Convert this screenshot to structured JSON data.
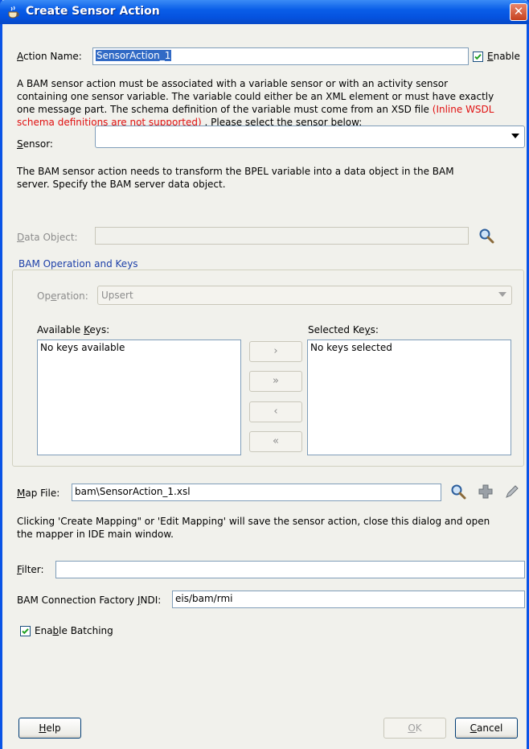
{
  "window": {
    "title": "Create Sensor Action",
    "close_glyph": "✕"
  },
  "action_name": {
    "label": "Action Name:",
    "mnemonic": "A",
    "rest": "ction Name:",
    "value": "SensorAction_1"
  },
  "enable": {
    "label_pre": "",
    "mnemonic": "E",
    "label_rest": "nable",
    "checked": true
  },
  "intro": {
    "line1": "A BAM sensor action must be associated with a variable sensor or with an activity sensor",
    "line2": "containing one sensor variable. The variable could either be an XML element or must have exactly",
    "line3_black": "one message part. The schema definition of the variable must come from an XSD file ",
    "line3_red": "(Inline WSDL",
    "line4_red": "schema definitions are not supported)",
    "line4_black": " . Please select the sensor below:"
  },
  "sensor": {
    "mnemonic": "S",
    "rest": "ensor:",
    "value": ""
  },
  "transform_text": {
    "line1": "The BAM sensor action needs to transform the BPEL variable into a data object in the BAM",
    "line2": "server. Specify the BAM server data object."
  },
  "data_object": {
    "mnemonic": "D",
    "rest": "ata Object:",
    "value": ""
  },
  "bam_group": {
    "title": "BAM Operation and Keys",
    "operation_pre": "Op",
    "operation_mnemonic": "e",
    "operation_rest": "ration:",
    "operation_value": "Upsert",
    "available_pre": "Available ",
    "available_mnemonic": "K",
    "available_rest": "eys:",
    "available_empty": "No keys available",
    "selected_pre": "Selected Ke",
    "selected_mnemonic": "y",
    "selected_rest": "s:",
    "selected_empty": "No keys selected",
    "shuttle_add": "›",
    "shuttle_add_all": "»",
    "shuttle_remove": "‹",
    "shuttle_remove_all": "«"
  },
  "map_file": {
    "mnemonic": "M",
    "rest": "ap File:",
    "value": "bam\\SensorAction_1.xsl"
  },
  "mapping_note": {
    "line1": "Clicking 'Create Mapping\" or 'Edit Mapping' will save the sensor action, close this dialog and open",
    "line2": "the mapper in IDE main window."
  },
  "filter": {
    "mnemonic": "F",
    "rest": "ilter:",
    "value": ""
  },
  "jndi": {
    "pre": "BAM Connection Factory ",
    "mnemonic": "J",
    "rest": "NDI:",
    "value": "eis/bam/rmi"
  },
  "batching": {
    "pre": "Ena",
    "mnemonic": "b",
    "rest": "le Batching",
    "checked": true
  },
  "buttons": {
    "help_mnemonic": "H",
    "help_rest": "elp",
    "ok_mnemonic": "O",
    "ok_rest": "K",
    "cancel_mnemonic": "C",
    "cancel_rest": "ancel"
  },
  "colors": {
    "title_bar": "#0a5ee8",
    "selection": "#316ac5",
    "warning_text": "#e01010",
    "group_title": "#1c3fa8"
  },
  "icons": [
    "coffee-cup-icon",
    "close-icon",
    "search-icon",
    "add-icon",
    "edit-pencil-icon",
    "check-icon",
    "dropdown-arrow-icon"
  ]
}
